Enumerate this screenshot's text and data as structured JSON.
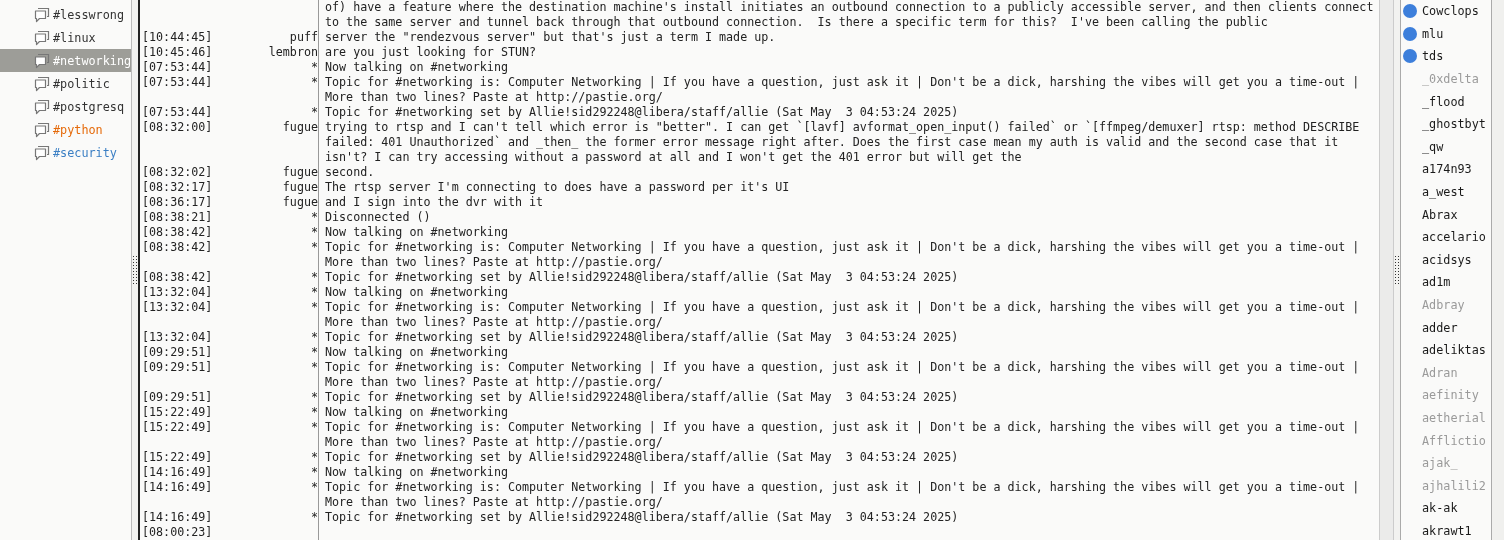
{
  "channels": [
    {
      "name": "#lesswrong",
      "selected": false,
      "color": "#333333"
    },
    {
      "name": "#linux",
      "selected": false,
      "color": "#333333"
    },
    {
      "name": "#networking",
      "selected": true,
      "color": "#ffffff"
    },
    {
      "name": "#politic",
      "selected": false,
      "color": "#333333"
    },
    {
      "name": "#postgresq",
      "selected": false,
      "color": "#333333"
    },
    {
      "name": "#python",
      "selected": false,
      "color": "#e56a0a"
    },
    {
      "name": "#security",
      "selected": false,
      "color": "#3b7fc4"
    }
  ],
  "messages": [
    {
      "text": "of) have a feature where the destination machine's install initiates an outbound connection to a publicly accessible server, and then clients connect to the same server and tunnel back through that outbound connection.  Is there a specific term for this?  I've been calling the public"
    },
    {
      "time": "[10:44:45]",
      "nick": "puff",
      "text": "server the \"rendezvous server\" but that's just a term I made up."
    },
    {
      "time": "[10:45:46]",
      "nick": "lembron",
      "text": "are you just looking for STUN?"
    },
    {
      "time": "[07:53:44]",
      "nick": "*",
      "text": "Now talking on #networking"
    },
    {
      "time": "[07:53:44]",
      "nick": "*",
      "text": "Topic for #networking is: Computer Networking | If you have a question, just ask it | Don't be a dick, harshing the vibes will get you a time-out | More than two lines? Paste at http://pastie.org/"
    },
    {
      "time": "[07:53:44]",
      "nick": "*",
      "text": "Topic for #networking set by Allie!sid292248@libera/staff/allie (Sat May  3 04:53:24 2025)"
    },
    {
      "time": "[08:32:00]",
      "nick": "fugue",
      "text": "trying to rtsp and I can't tell which error is \"better\". I can get `[lavf] avformat_open_input() failed` or `[ffmpeg/demuxer] rtsp: method DESCRIBE failed: 401 Unauthorized` and _then_ the former error message right after. Does the first case mean my auth is valid and the second case that it isn't? I can try accessing without a password at all and I won't get the 401 error but will get the"
    },
    {
      "time": "[08:32:02]",
      "nick": "fugue",
      "text": "second."
    },
    {
      "time": "[08:32:17]",
      "nick": "fugue",
      "text": "The rtsp server I'm connecting to does have a password per it's UI"
    },
    {
      "time": "[08:36:17]",
      "nick": "fugue",
      "text": "and I sign into the dvr with it"
    },
    {
      "time": "[08:38:21]",
      "nick": "*",
      "text": "Disconnected ()"
    },
    {
      "time": "[08:38:42]",
      "nick": "*",
      "text": "Now talking on #networking"
    },
    {
      "time": "[08:38:42]",
      "nick": "*",
      "text": "Topic for #networking is: Computer Networking | If you have a question, just ask it | Don't be a dick, harshing the vibes will get you a time-out | More than two lines? Paste at http://pastie.org/"
    },
    {
      "time": "[08:38:42]",
      "nick": "*",
      "text": "Topic for #networking set by Allie!sid292248@libera/staff/allie (Sat May  3 04:53:24 2025)"
    },
    {
      "time": "[13:32:04]",
      "nick": "*",
      "text": "Now talking on #networking"
    },
    {
      "time": "[13:32:04]",
      "nick": "*",
      "text": "Topic for #networking is: Computer Networking | If you have a question, just ask it | Don't be a dick, harshing the vibes will get you a time-out | More than two lines? Paste at http://pastie.org/"
    },
    {
      "time": "[13:32:04]",
      "nick": "*",
      "text": "Topic for #networking set by Allie!sid292248@libera/staff/allie (Sat May  3 04:53:24 2025)"
    },
    {
      "time": "[09:29:51]",
      "nick": "*",
      "text": "Now talking on #networking"
    },
    {
      "time": "[09:29:51]",
      "nick": "*",
      "text": "Topic for #networking is: Computer Networking | If you have a question, just ask it | Don't be a dick, harshing the vibes will get you a time-out | More than two lines? Paste at http://pastie.org/"
    },
    {
      "time": "[09:29:51]",
      "nick": "*",
      "text": "Topic for #networking set by Allie!sid292248@libera/staff/allie (Sat May  3 04:53:24 2025)"
    },
    {
      "time": "[15:22:49]",
      "nick": "*",
      "text": "Now talking on #networking"
    },
    {
      "time": "[15:22:49]",
      "nick": "*",
      "text": "Topic for #networking is: Computer Networking | If you have a question, just ask it | Don't be a dick, harshing the vibes will get you a time-out | More than two lines? Paste at http://pastie.org/"
    },
    {
      "time": "[15:22:49]",
      "nick": "*",
      "text": "Topic for #networking set by Allie!sid292248@libera/staff/allie (Sat May  3 04:53:24 2025)"
    },
    {
      "time": "[14:16:49]",
      "nick": "*",
      "text": "Now talking on #networking"
    },
    {
      "time": "[14:16:49]",
      "nick": "*",
      "text": "Topic for #networking is: Computer Networking | If you have a question, just ask it | Don't be a dick, harshing the vibes will get you a time-out | More than two lines? Paste at http://pastie.org/"
    },
    {
      "time": "[14:16:49]",
      "nick": "*",
      "text": "Topic for #networking set by Allie!sid292248@libera/staff/allie (Sat May  3 04:53:24 2025)"
    },
    {
      "time": "[08:00:23]"
    }
  ],
  "users": [
    {
      "name": "Cowclops",
      "op": true,
      "away": false
    },
    {
      "name": "mlu",
      "op": true,
      "away": false
    },
    {
      "name": "tds",
      "op": true,
      "away": false
    },
    {
      "name": "_0xdelta",
      "op": false,
      "away": true
    },
    {
      "name": "_flood",
      "op": false,
      "away": false
    },
    {
      "name": "_ghostbyt",
      "op": false,
      "away": false
    },
    {
      "name": "_qw",
      "op": false,
      "away": false
    },
    {
      "name": "a174n93",
      "op": false,
      "away": false
    },
    {
      "name": "a_west",
      "op": false,
      "away": false
    },
    {
      "name": "Abrax",
      "op": false,
      "away": false
    },
    {
      "name": "accelario",
      "op": false,
      "away": false
    },
    {
      "name": "acidsys",
      "op": false,
      "away": false
    },
    {
      "name": "ad1m",
      "op": false,
      "away": false
    },
    {
      "name": "Adbray",
      "op": false,
      "away": true
    },
    {
      "name": "adder",
      "op": false,
      "away": false
    },
    {
      "name": "adeliktas",
      "op": false,
      "away": false
    },
    {
      "name": "Adran",
      "op": false,
      "away": true
    },
    {
      "name": "aefinity",
      "op": false,
      "away": true
    },
    {
      "name": "aetherial",
      "op": false,
      "away": true
    },
    {
      "name": "Afflictio",
      "op": false,
      "away": true
    },
    {
      "name": "ajak_",
      "op": false,
      "away": true
    },
    {
      "name": "ajhalili2",
      "op": false,
      "away": true
    },
    {
      "name": "ak-ak",
      "op": false,
      "away": false
    },
    {
      "name": "akrawt1",
      "op": false,
      "away": false
    }
  ]
}
